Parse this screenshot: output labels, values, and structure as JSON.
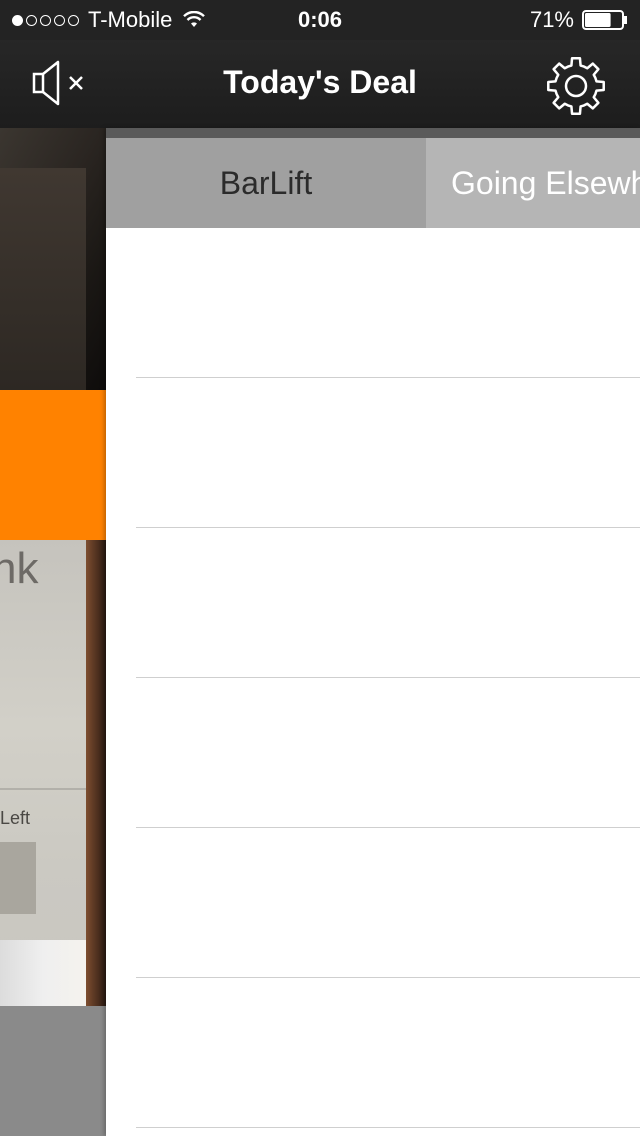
{
  "status_bar": {
    "carrier": "T-Mobile",
    "time": "0:06",
    "battery_percent": "71%",
    "signal_bars_filled": 1,
    "signal_bars_total": 5,
    "battery_level": 0.71
  },
  "nav": {
    "title": "Today's Deal",
    "left_icon": "mute-speaker-icon",
    "right_icon": "gear-icon"
  },
  "background_card": {
    "word": "nk",
    "left_label": "Left",
    "orange_text": "!"
  },
  "tabs": [
    {
      "label": "BarLift",
      "selected": true
    },
    {
      "label": "Going Elsewhere",
      "selected": false
    }
  ],
  "list_rows": 6,
  "colors": {
    "accent_orange": "#ff8200",
    "nav_bg": "#232323",
    "tab_selected": "#a0a0a0",
    "tab_unselected": "#b5b5b5"
  }
}
